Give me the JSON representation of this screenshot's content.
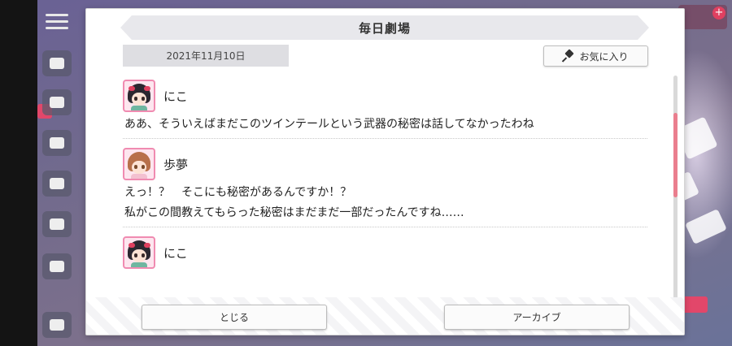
{
  "dialog": {
    "title": "毎日劇場",
    "date": "2021年11月10日",
    "favorite_label": "お気に入り",
    "close_label": "とじる",
    "archive_label": "アーカイブ"
  },
  "messages": [
    {
      "speaker": "にこ",
      "avatar_icon": "niko-avatar-icon",
      "lines": [
        "ああ、そういえばまだこのツインテールという武器の秘密は話してなかったわね"
      ]
    },
    {
      "speaker": "歩夢",
      "avatar_icon": "ayumu-avatar-icon",
      "lines": [
        "えっ！？　そこにも秘密があるんですか！？",
        "私がこの間教えてもらった秘密はまだまだ一部だったんですね……"
      ]
    },
    {
      "speaker": "にこ",
      "avatar_icon": "niko-avatar-icon",
      "lines": []
    }
  ],
  "colors": {
    "accent": "#ea7e8e",
    "avatar_border": "#f08bb1"
  }
}
